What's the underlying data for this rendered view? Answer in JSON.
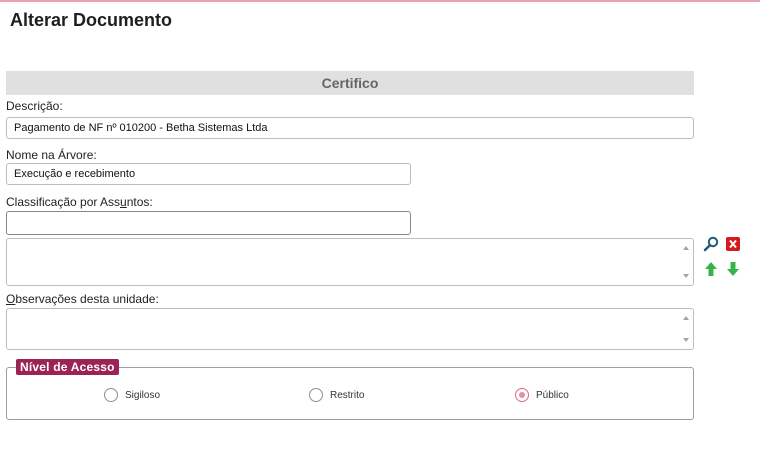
{
  "page": {
    "title": "Alterar Documento",
    "section_title": "Certifico"
  },
  "fields": {
    "descricao": {
      "label": "Descrição:",
      "value": "Pagamento de NF nº 010200 - Betha Sistemas Ltda"
    },
    "nome_arvore": {
      "label": "Nome na Árvore:",
      "value": "Execução e recebimento"
    },
    "classificacao": {
      "label": "Classificação por Assuntos:",
      "value": ""
    },
    "observacoes": {
      "label": "Observações desta unidade:",
      "value": ""
    }
  },
  "acesso": {
    "legend": "Nível de Acesso",
    "options": [
      {
        "label": "Sigiloso",
        "selected": false
      },
      {
        "label": "Restrito",
        "selected": false
      },
      {
        "label": "Público",
        "selected": true
      }
    ]
  },
  "icons": {
    "search": "search-icon",
    "remove": "remove-icon",
    "move_up": "arrow-up-icon",
    "move_down": "arrow-down-icon"
  },
  "colors": {
    "accent": "#9b2355",
    "top_border": "#e8a3b1",
    "section_bg": "#e0e0e0",
    "search_icon": "#1e5b7a",
    "remove_icon": "#d71920",
    "arrow_icon": "#38b34a"
  }
}
